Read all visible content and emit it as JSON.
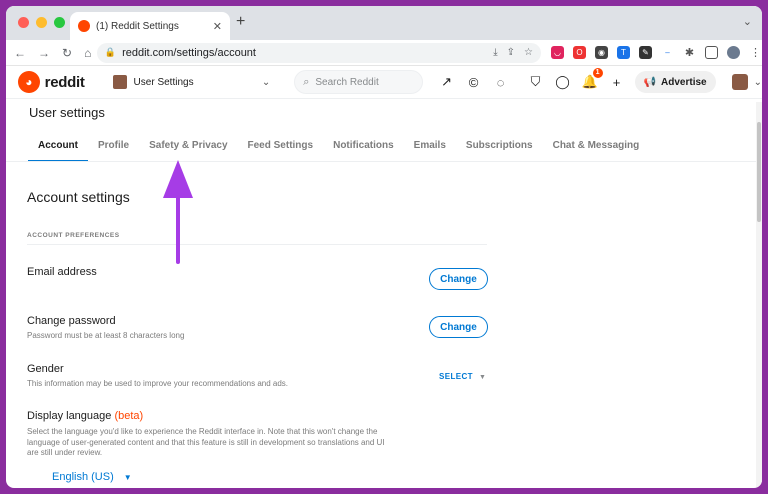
{
  "browser": {
    "tab_title": "(1) Reddit Settings",
    "url": "reddit.com/settings/account"
  },
  "header": {
    "brand": "reddit",
    "community": "User Settings",
    "search_placeholder": "Search Reddit",
    "notification_count": "1",
    "advertise": "Advertise"
  },
  "page": {
    "title": "User settings",
    "tabs": [
      {
        "label": "Account"
      },
      {
        "label": "Profile"
      },
      {
        "label": "Safety & Privacy"
      },
      {
        "label": "Feed Settings"
      },
      {
        "label": "Notifications"
      },
      {
        "label": "Emails"
      },
      {
        "label": "Subscriptions"
      },
      {
        "label": "Chat & Messaging"
      }
    ],
    "section_title": "Account settings",
    "preferences_label": "ACCOUNT PREFERENCES",
    "email": {
      "title": "Email address",
      "button": "Change"
    },
    "password": {
      "title": "Change password",
      "subtitle": "Password must be at least 8 characters long",
      "button": "Change"
    },
    "gender": {
      "title": "Gender",
      "subtitle": "This information may be used to improve your recommendations and ads.",
      "select": "SELECT"
    },
    "language": {
      "title": "Display language",
      "beta": "(beta)",
      "subtitle": "Select the language you'd like to experience the Reddit interface in. Note that this won't change the language of user-generated content and that this feature is still in development so translations and UI are still under review.",
      "value": "English (US)"
    }
  },
  "colors": {
    "accent": "#0079d3",
    "brand": "#ff4500",
    "annotation": "#a63ce6"
  }
}
